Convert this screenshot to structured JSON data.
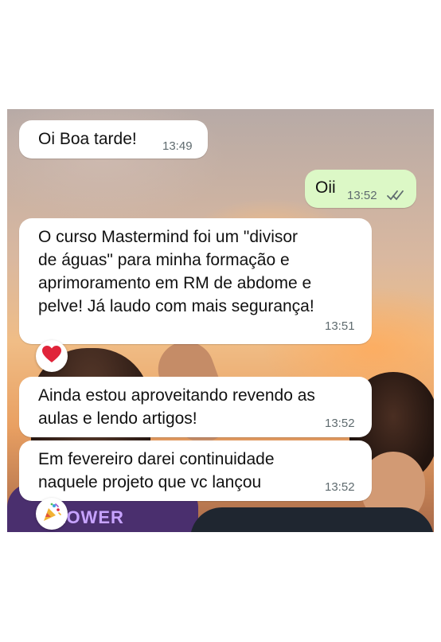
{
  "messages": [
    {
      "text": "Oi Boa tarde!",
      "time": "13:49",
      "direction": "in"
    },
    {
      "text": "Oii",
      "time": "13:52",
      "direction": "out",
      "status_icon": "double-check-icon"
    },
    {
      "text": "O curso Mastermind foi um \"divisor\nde águas\" para minha formação e\naprimoramento em RM  de abdome e\npelve! Já laudo com mais segurança!",
      "time": "13:51",
      "direction": "in",
      "reaction": "heart-icon"
    },
    {
      "text": "Ainda estou aproveitando revendo as\naulas e lendo artigos!",
      "time": "13:52",
      "direction": "in"
    },
    {
      "text": "Em fevereiro darei continuidade\nnaquele projeto que vc lançou",
      "time": "13:52",
      "direction": "in",
      "reaction": "party-popper-icon"
    }
  ],
  "wallpaper": {
    "shirt_text": "LOWER"
  },
  "colors": {
    "incoming_bubble": "#ffffff",
    "outgoing_bubble": "#dcf8c6",
    "heart": "#e0243a",
    "timestamp": "#5f6b6f"
  }
}
